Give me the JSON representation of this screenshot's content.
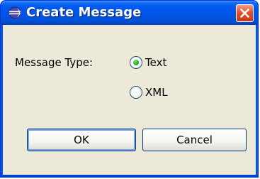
{
  "window": {
    "title": "Create Message",
    "title_icon": "eclipse-icon",
    "close_icon": "close-icon"
  },
  "form": {
    "message_type_label": "Message Type:",
    "options": [
      {
        "label": "Text",
        "selected": true
      },
      {
        "label": "XML",
        "selected": false
      }
    ]
  },
  "buttons": {
    "ok_label": "OK",
    "cancel_label": "Cancel"
  },
  "colors": {
    "titlebar": "#0058ee",
    "client_bg": "#ece9d8",
    "close_button": "#e0512e",
    "radio_selected": "#21a121"
  }
}
